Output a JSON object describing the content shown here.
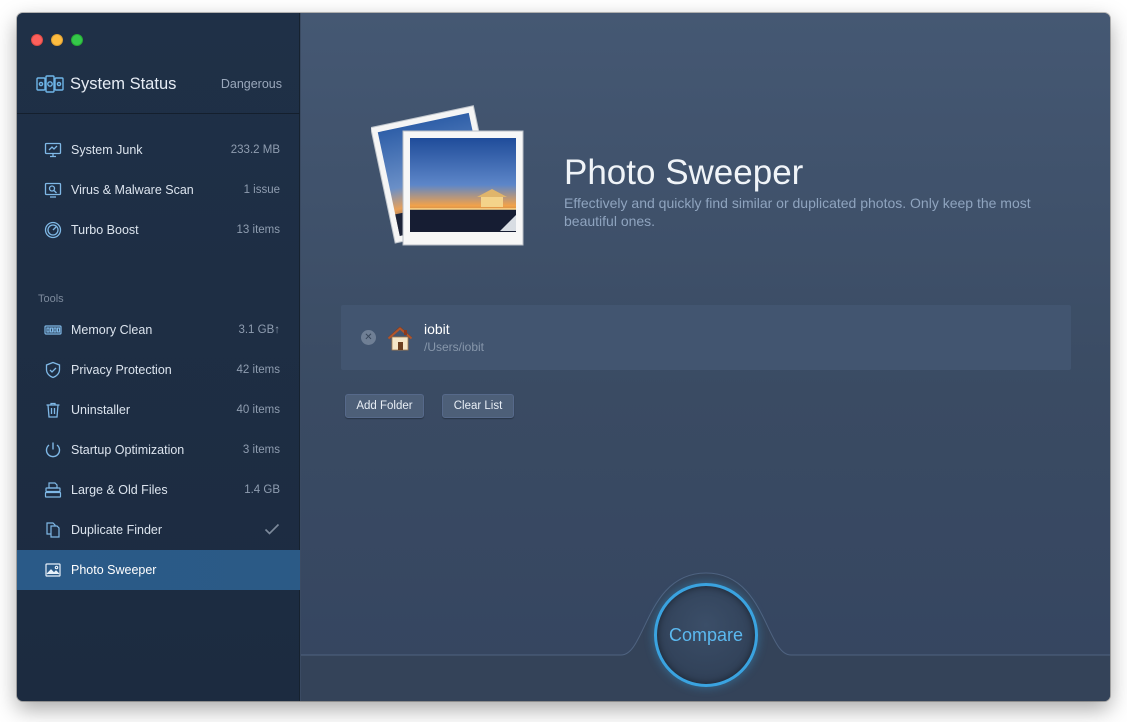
{
  "sidebar": {
    "status": {
      "title": "System Status",
      "value": "Dangerous"
    },
    "items": [
      {
        "label": "System Junk",
        "count": "233.2 MB",
        "icon": "monitor-icon"
      },
      {
        "label": "Virus & Malware Scan",
        "count": "1 issue",
        "icon": "magnifier-screen-icon"
      },
      {
        "label": "Turbo Boost",
        "count": "13 items",
        "icon": "speedometer-icon"
      }
    ],
    "tools_label": "Tools",
    "tools": [
      {
        "label": "Memory Clean",
        "count": "3.1 GB↑",
        "icon": "memory-chip-icon"
      },
      {
        "label": "Privacy Protection",
        "count": "42 items",
        "icon": "shield-icon"
      },
      {
        "label": "Uninstaller",
        "count": "40 items",
        "icon": "trash-icon"
      },
      {
        "label": "Startup Optimization",
        "count": "3 items",
        "icon": "power-icon"
      },
      {
        "label": "Large & Old Files",
        "count": "1.4 GB",
        "icon": "stack-files-icon"
      },
      {
        "label": "Duplicate Finder",
        "count": "",
        "icon": "duplicate-icon"
      },
      {
        "label": "Photo Sweeper",
        "count": "",
        "icon": "photo-icon"
      }
    ]
  },
  "main": {
    "title": "Photo Sweeper",
    "description": "Effectively and quickly find similar or duplicated photos. Only keep the most beautiful ones.",
    "folder": {
      "name": "iobit",
      "path": "/Users/iobit"
    },
    "add_folder_label": "Add Folder",
    "clear_list_label": "Clear List",
    "compare_label": "Compare"
  },
  "colors": {
    "accent": "#3aa3e0",
    "active_item": "#2a5a88",
    "sidebar_bg": "#1f3047",
    "main_bg": "#3b4b63"
  }
}
